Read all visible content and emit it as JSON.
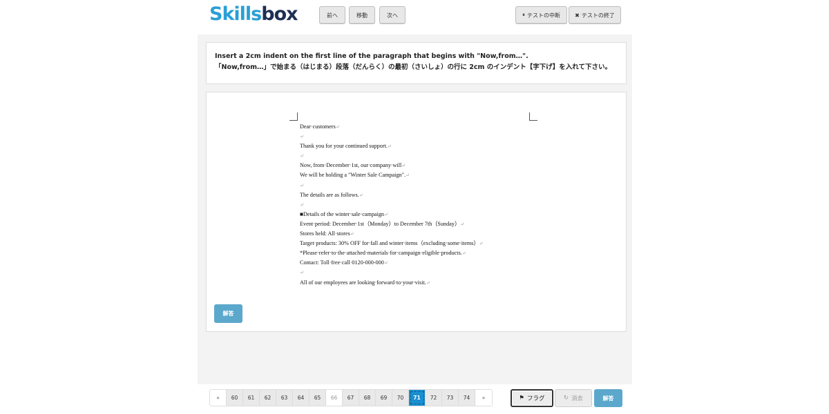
{
  "app": {
    "logo_part1": "Skills",
    "logo_part2": "box"
  },
  "header": {
    "prev_label": "前へ",
    "move_label": "移動",
    "next_label": "次へ",
    "pause_label": "テストの中断",
    "end_label": "テストの終了"
  },
  "question": {
    "line_en": "Insert a 2cm indent on the first line of the paragraph that begins with \"Now,from…\".",
    "line_ja": "「Now,from…」で始まる（はじまる）段落（だんらく）の最初（さいしょ）の行に 2cm のインデント【字下げ】を入れて下さい。"
  },
  "document": {
    "lines": [
      "Dear·customers",
      "",
      "Thank you for your continued support.",
      "",
      "Now, from·December·1st, our·company·will",
      "We will be holding a \"Winter Sale Campaign\".",
      "",
      "The details are as follows.",
      "",
      "■Details of the winter·sale·campaign",
      "Event·period: December·1st（Monday）to December 7th（Sunday）",
      "Stores held: All·stores",
      "Target·products: 30% OFF for·fall and winter·items（excluding·some·items）",
      "*Please·refer·to·the·attached·materials·for·campaign·eligible·products.",
      "Contact: Toll·free·call·0120-000-000",
      "",
      "All of our employees are looking·forward·to·your·visit."
    ],
    "para_mark": "↵"
  },
  "workarea": {
    "answer_label": "解答"
  },
  "footer": {
    "pager": {
      "prev": "«",
      "next": "»",
      "pages": [
        "60",
        "61",
        "62",
        "63",
        "64",
        "65",
        "66",
        "67",
        "68",
        "69",
        "70",
        "71",
        "72",
        "73",
        "74"
      ],
      "current": "71",
      "visited_light": "66"
    },
    "flag_label": "フラグ",
    "clear_label": "消去",
    "answer_label": "解答"
  },
  "colors": {
    "accent": "#1a8fd0",
    "answer_button": "#5ba8cc",
    "logo_skills": "#2a9fd6",
    "logo_box": "#1e2f54"
  }
}
